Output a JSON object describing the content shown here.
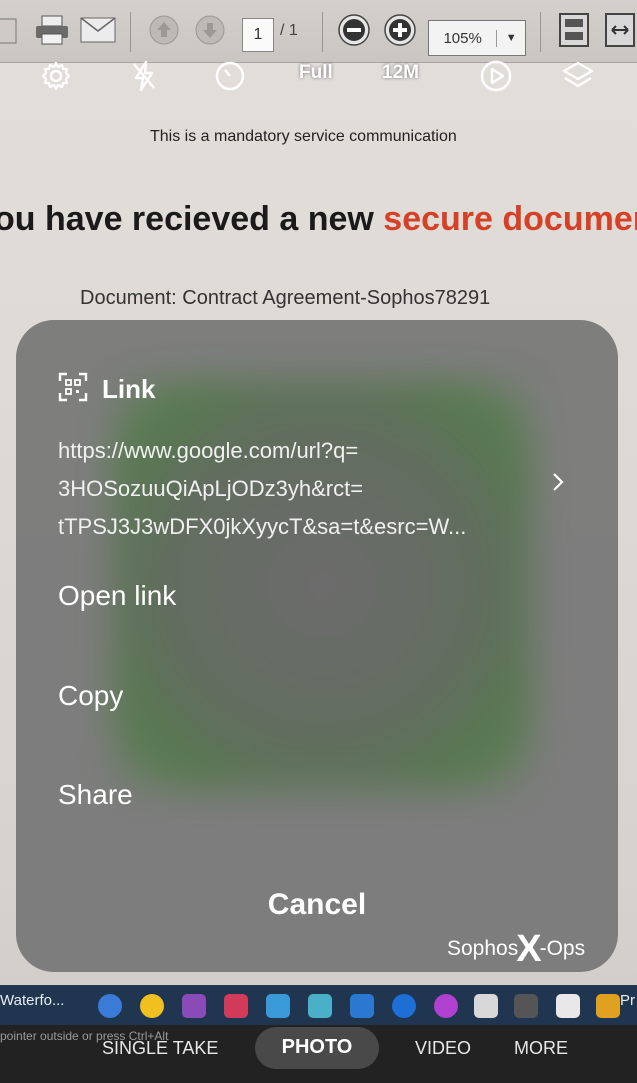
{
  "viewer": {
    "page_current": "1",
    "page_total": "/ 1",
    "zoom": "105%"
  },
  "camera_top": {
    "ratio_label": "Full",
    "resolution_label": "12M",
    "icons": [
      "settings-icon",
      "flash-off-icon",
      "timer-icon",
      "motion-photo-icon",
      "filter-icon"
    ]
  },
  "email": {
    "notice": "This is a mandatory service communication",
    "heading_prefix": "ou have recieved a new ",
    "heading_highlight": "secure documer",
    "document_line": "Document: Contract Agreement-Sophos78291"
  },
  "link_sheet": {
    "title": "Link",
    "url_lines": [
      "https://www.google.com/url?q=",
      "3HOSozuuQiApLjODz3yh&rct=",
      "tTPSJ3J3wDFX0jkXyycT&sa=t&esrc=W..."
    ],
    "actions": {
      "open": "Open link",
      "copy": "Copy",
      "share": "Share",
      "cancel": "Cancel"
    },
    "watermark": {
      "left": "Sophos",
      "x": "X",
      "right": "-Ops"
    }
  },
  "taskbar": {
    "window_label": "Waterfo...",
    "status_hint": "pointer outside or press Ctrl+Alt",
    "edge_right": "Pr"
  },
  "camera_modes": {
    "single_take": "SINGLE TAKE",
    "photo": "PHOTO",
    "video": "VIDEO",
    "more": "MORE"
  },
  "colors": {
    "accent_red": "#d64027",
    "sheet_bg": "#767676"
  }
}
